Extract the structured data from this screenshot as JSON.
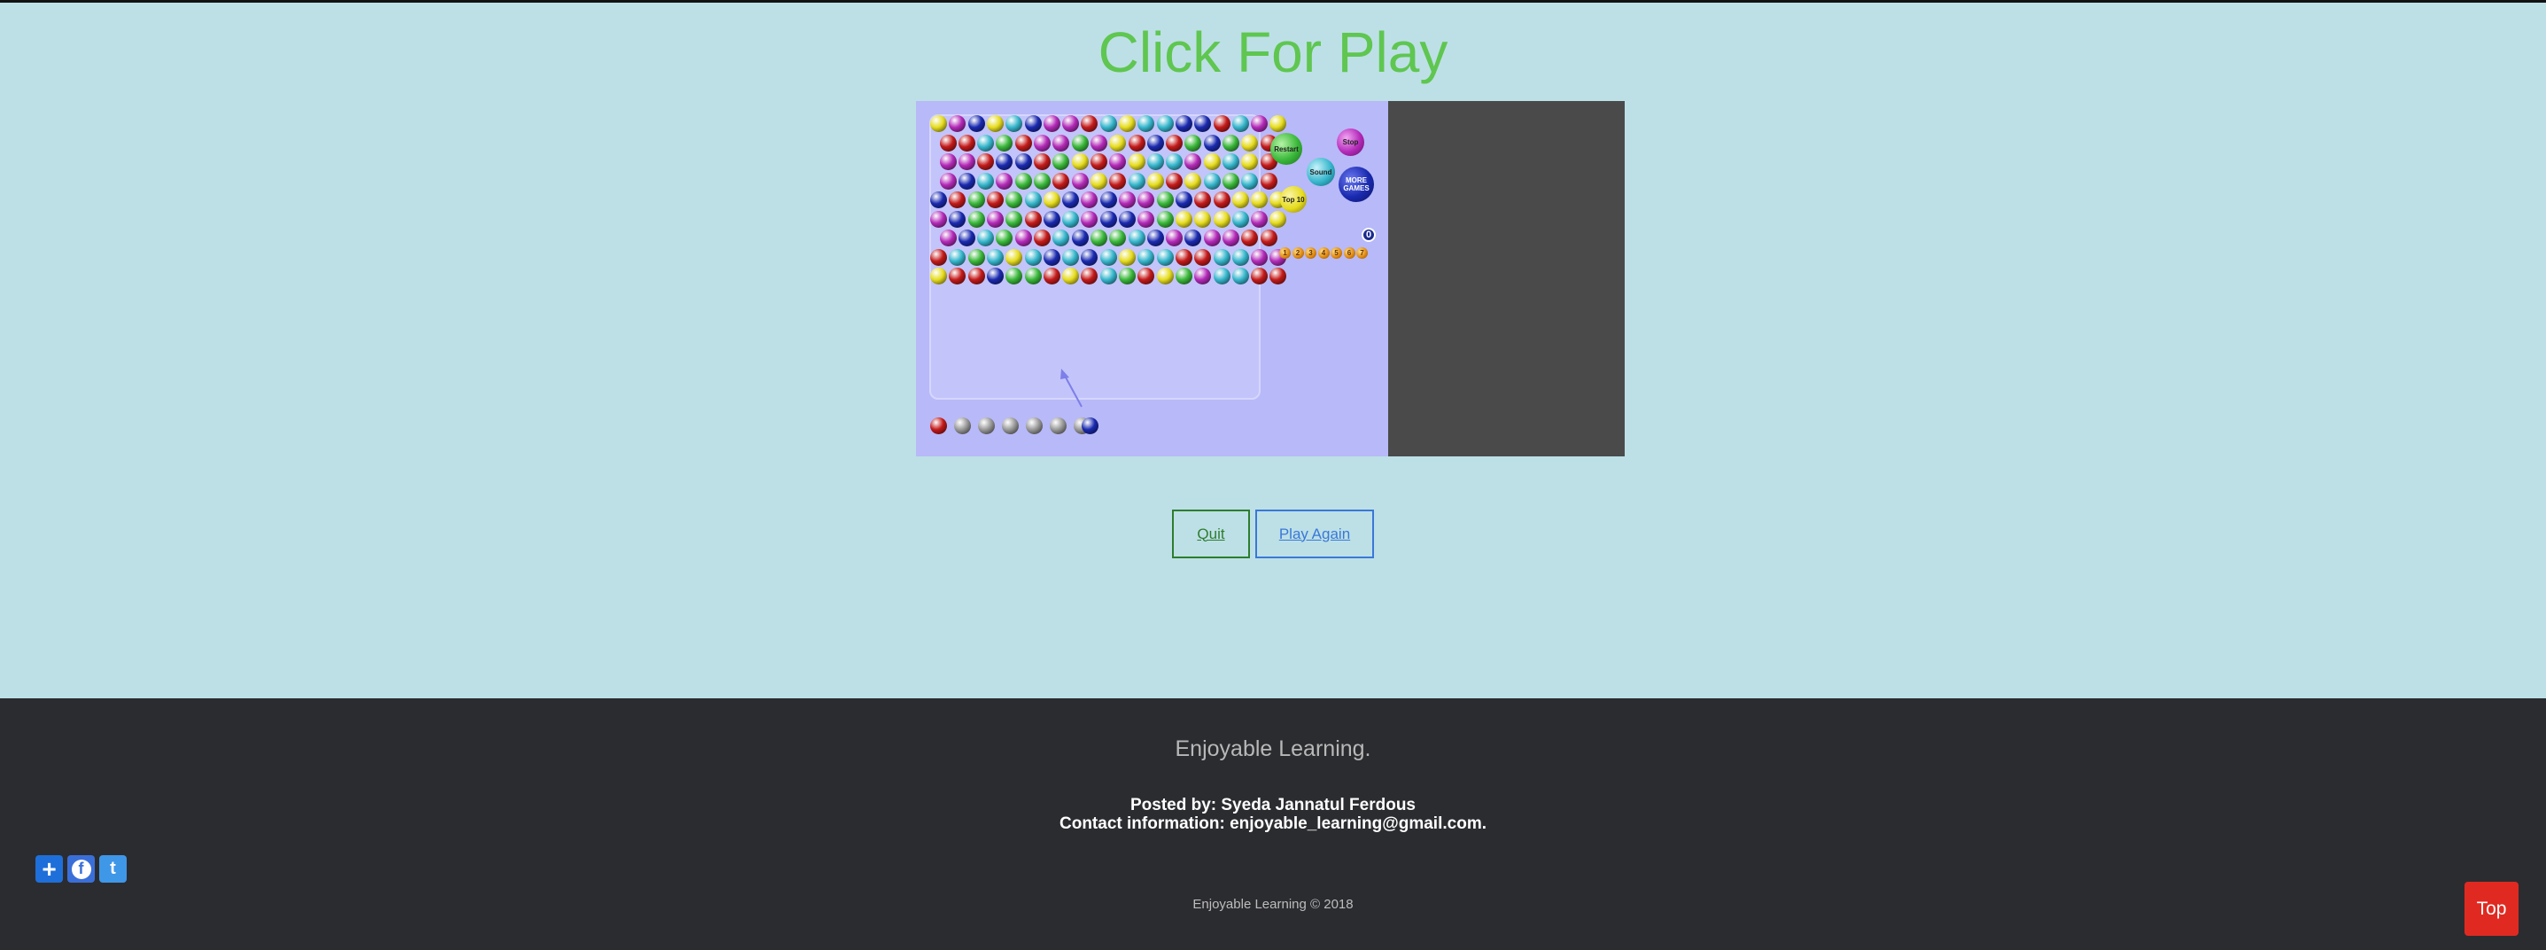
{
  "header": {
    "title": "Click For Play"
  },
  "game": {
    "colors": {
      "yellow": "#e6dc1e",
      "purple": "#b32ab8",
      "blue": "#1a2ab0",
      "cyan": "#36b6cc",
      "red": "#c41a1a",
      "green": "#3ab83a",
      "gray": "#9a9a9a",
      "canvas": "#b8b9f8",
      "side_panel": "#4a4a4a"
    },
    "grid_rows": [
      "YPBYCBPPRCYCCBBRCPY",
      "RRCGRPPGPYRBRGBGYR",
      "PPRBBRGYRPYCCPYCYR",
      "PBCPGGRPYRCYRYCGCR",
      "BRGRGCYBPBPPGBRRYYY",
      "PBGPGRBCPBBPGYYYCPY",
      "PBCGPRCBGGCBPBPPRR",
      "RCGCYCBCBCYCCRRCCPP",
      "YRRBGGRYRCGRYGPCCRR"
    ],
    "shooter_queue": [
      "R",
      "X",
      "X",
      "X",
      "X",
      "X",
      "X"
    ],
    "current_bubble": "B",
    "controls": {
      "restart": "Restart",
      "stop": "Stop",
      "sound": "Sound",
      "more_games": "MORE GAMES",
      "top10": "Top 10"
    },
    "score": "0",
    "level_digits": [
      "1",
      "2",
      "3",
      "4",
      "5",
      "6",
      "7"
    ]
  },
  "actions": {
    "quit": "Quit",
    "play_again": "Play Again"
  },
  "footer": {
    "tagline": "Enjoyable Learning.",
    "posted_by": "Posted by: Syeda Jannatul Ferdous",
    "contact": "Contact information: enjoyable_learning@gmail.com.",
    "copyright": "Enjoyable Learning © 2018",
    "top_button": "Top"
  },
  "share": {
    "icons": [
      "add-share-icon",
      "facebook-icon",
      "twitter-icon"
    ],
    "add_symbol": "+",
    "facebook_symbol": "f",
    "twitter_symbol": "t",
    "colors": {
      "add": "#1e6fd9",
      "facebook": "#3b6fd8",
      "twitter": "#3f97e8"
    }
  }
}
